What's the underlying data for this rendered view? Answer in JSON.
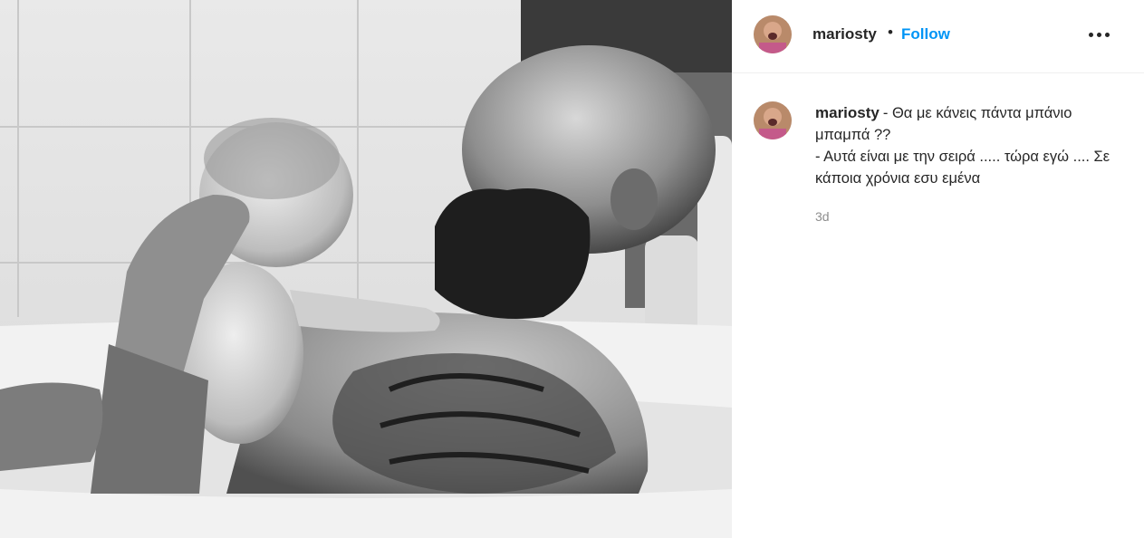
{
  "post": {
    "photo_alt": "Black and white photo of a bearded tattooed man in a bathtub holding a newborn baby",
    "author": {
      "username": "mariosty",
      "follow_label": "Follow",
      "separator": "•"
    },
    "more_icon": "more-options-icon",
    "caption": {
      "username": "mariosty",
      "lines": [
        "- Θα με κάνεις πάντα μπάνιο μπαμπά ??",
        "- Αυτά είναι με την σειρά ..... τώρα εγώ .... Σε κάποια χρόνια εσυ εμένα"
      ]
    },
    "timestamp": "3d"
  },
  "colors": {
    "follow": "#0095f6",
    "text": "#262626",
    "muted": "#8e8e8e",
    "divider": "#efefef"
  }
}
